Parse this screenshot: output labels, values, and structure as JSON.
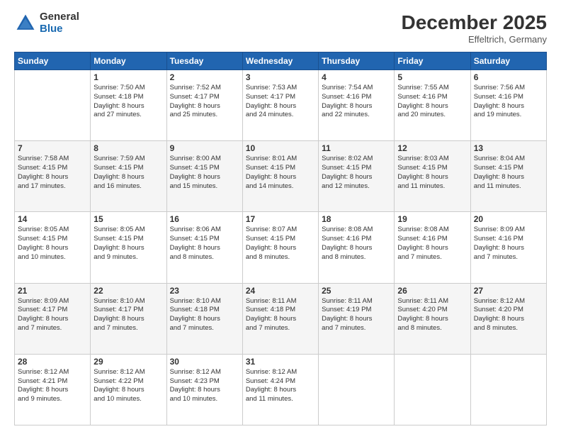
{
  "header": {
    "logo_general": "General",
    "logo_blue": "Blue",
    "month_title": "December 2025",
    "location": "Effeltrich, Germany"
  },
  "days_of_week": [
    "Sunday",
    "Monday",
    "Tuesday",
    "Wednesday",
    "Thursday",
    "Friday",
    "Saturday"
  ],
  "weeks": [
    [
      {
        "day": "",
        "info": ""
      },
      {
        "day": "1",
        "info": "Sunrise: 7:50 AM\nSunset: 4:18 PM\nDaylight: 8 hours\nand 27 minutes."
      },
      {
        "day": "2",
        "info": "Sunrise: 7:52 AM\nSunset: 4:17 PM\nDaylight: 8 hours\nand 25 minutes."
      },
      {
        "day": "3",
        "info": "Sunrise: 7:53 AM\nSunset: 4:17 PM\nDaylight: 8 hours\nand 24 minutes."
      },
      {
        "day": "4",
        "info": "Sunrise: 7:54 AM\nSunset: 4:16 PM\nDaylight: 8 hours\nand 22 minutes."
      },
      {
        "day": "5",
        "info": "Sunrise: 7:55 AM\nSunset: 4:16 PM\nDaylight: 8 hours\nand 20 minutes."
      },
      {
        "day": "6",
        "info": "Sunrise: 7:56 AM\nSunset: 4:16 PM\nDaylight: 8 hours\nand 19 minutes."
      }
    ],
    [
      {
        "day": "7",
        "info": "Sunrise: 7:58 AM\nSunset: 4:15 PM\nDaylight: 8 hours\nand 17 minutes."
      },
      {
        "day": "8",
        "info": "Sunrise: 7:59 AM\nSunset: 4:15 PM\nDaylight: 8 hours\nand 16 minutes."
      },
      {
        "day": "9",
        "info": "Sunrise: 8:00 AM\nSunset: 4:15 PM\nDaylight: 8 hours\nand 15 minutes."
      },
      {
        "day": "10",
        "info": "Sunrise: 8:01 AM\nSunset: 4:15 PM\nDaylight: 8 hours\nand 14 minutes."
      },
      {
        "day": "11",
        "info": "Sunrise: 8:02 AM\nSunset: 4:15 PM\nDaylight: 8 hours\nand 12 minutes."
      },
      {
        "day": "12",
        "info": "Sunrise: 8:03 AM\nSunset: 4:15 PM\nDaylight: 8 hours\nand 11 minutes."
      },
      {
        "day": "13",
        "info": "Sunrise: 8:04 AM\nSunset: 4:15 PM\nDaylight: 8 hours\nand 11 minutes."
      }
    ],
    [
      {
        "day": "14",
        "info": "Sunrise: 8:05 AM\nSunset: 4:15 PM\nDaylight: 8 hours\nand 10 minutes."
      },
      {
        "day": "15",
        "info": "Sunrise: 8:05 AM\nSunset: 4:15 PM\nDaylight: 8 hours\nand 9 minutes."
      },
      {
        "day": "16",
        "info": "Sunrise: 8:06 AM\nSunset: 4:15 PM\nDaylight: 8 hours\nand 8 minutes."
      },
      {
        "day": "17",
        "info": "Sunrise: 8:07 AM\nSunset: 4:15 PM\nDaylight: 8 hours\nand 8 minutes."
      },
      {
        "day": "18",
        "info": "Sunrise: 8:08 AM\nSunset: 4:16 PM\nDaylight: 8 hours\nand 8 minutes."
      },
      {
        "day": "19",
        "info": "Sunrise: 8:08 AM\nSunset: 4:16 PM\nDaylight: 8 hours\nand 7 minutes."
      },
      {
        "day": "20",
        "info": "Sunrise: 8:09 AM\nSunset: 4:16 PM\nDaylight: 8 hours\nand 7 minutes."
      }
    ],
    [
      {
        "day": "21",
        "info": "Sunrise: 8:09 AM\nSunset: 4:17 PM\nDaylight: 8 hours\nand 7 minutes."
      },
      {
        "day": "22",
        "info": "Sunrise: 8:10 AM\nSunset: 4:17 PM\nDaylight: 8 hours\nand 7 minutes."
      },
      {
        "day": "23",
        "info": "Sunrise: 8:10 AM\nSunset: 4:18 PM\nDaylight: 8 hours\nand 7 minutes."
      },
      {
        "day": "24",
        "info": "Sunrise: 8:11 AM\nSunset: 4:18 PM\nDaylight: 8 hours\nand 7 minutes."
      },
      {
        "day": "25",
        "info": "Sunrise: 8:11 AM\nSunset: 4:19 PM\nDaylight: 8 hours\nand 7 minutes."
      },
      {
        "day": "26",
        "info": "Sunrise: 8:11 AM\nSunset: 4:20 PM\nDaylight: 8 hours\nand 8 minutes."
      },
      {
        "day": "27",
        "info": "Sunrise: 8:12 AM\nSunset: 4:20 PM\nDaylight: 8 hours\nand 8 minutes."
      }
    ],
    [
      {
        "day": "28",
        "info": "Sunrise: 8:12 AM\nSunset: 4:21 PM\nDaylight: 8 hours\nand 9 minutes."
      },
      {
        "day": "29",
        "info": "Sunrise: 8:12 AM\nSunset: 4:22 PM\nDaylight: 8 hours\nand 10 minutes."
      },
      {
        "day": "30",
        "info": "Sunrise: 8:12 AM\nSunset: 4:23 PM\nDaylight: 8 hours\nand 10 minutes."
      },
      {
        "day": "31",
        "info": "Sunrise: 8:12 AM\nSunset: 4:24 PM\nDaylight: 8 hours\nand 11 minutes."
      },
      {
        "day": "",
        "info": ""
      },
      {
        "day": "",
        "info": ""
      },
      {
        "day": "",
        "info": ""
      }
    ]
  ]
}
